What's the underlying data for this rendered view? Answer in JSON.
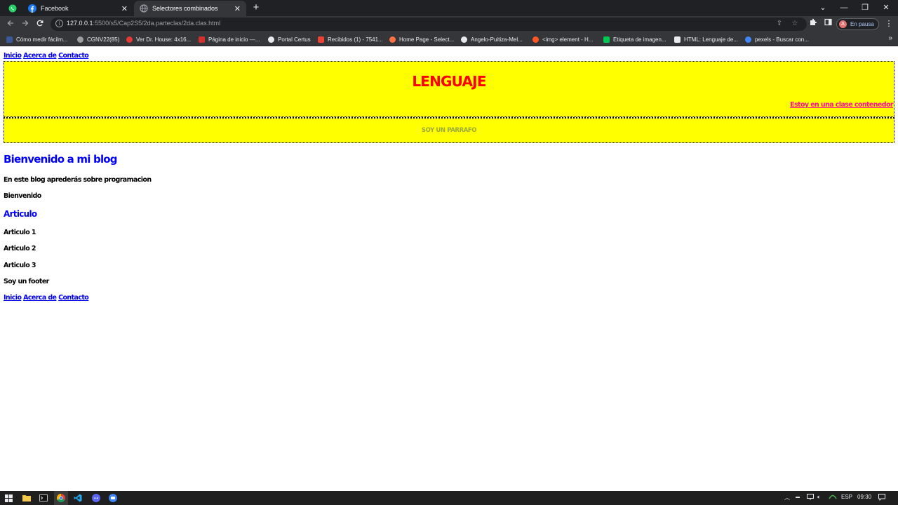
{
  "browser": {
    "tabs": [
      {
        "label": "Facebook",
        "active": false,
        "close": "✕"
      },
      {
        "label": "Selectores combinados",
        "active": true,
        "close": "✕"
      }
    ],
    "new_tab": "+",
    "window_controls": {
      "collapse": "⌄",
      "minimize": "—",
      "restore": "❐",
      "close": "✕"
    },
    "url_host": "127.0.0.1",
    "url_rest": ":5500/s5/Cap2S5/2da.parteclas/2da.clas.html",
    "profile_initial": "A",
    "profile_status": "En pausa",
    "bookmarks": [
      {
        "label": "Cómo medir fácilm...",
        "color": "#3b5998"
      },
      {
        "label": "CGNV22(85)",
        "color": "#9e9e9e"
      },
      {
        "label": "Ver Dr. House: 4x16...",
        "color": "#e53935"
      },
      {
        "label": "Página de inicio —...",
        "color": "#d32f2f"
      },
      {
        "label": "Portal Certus",
        "color": "#e8eaed"
      },
      {
        "label": "Recibidos (1) - 7541...",
        "color": "#ea4335"
      },
      {
        "label": "Home Page - Select...",
        "color": "#ff7043"
      },
      {
        "label": "Angelo-Puitiza-Mel...",
        "color": "#e8eaed"
      },
      {
        "label": "<img> element - H...",
        "color": "#ff5722"
      },
      {
        "label": "Etiqueta de imagen...",
        "color": "#00c853"
      },
      {
        "label": "HTML: Lenguaje de...",
        "color": "#e8eaed"
      },
      {
        "label": "pexels - Buscar con...",
        "color": "#4285f4"
      }
    ],
    "bookmarks_more": "»"
  },
  "page": {
    "nav_top": {
      "links": [
        "Inicio",
        "Acerca de",
        "Contacto"
      ]
    },
    "header_title": "LENGUAJE",
    "container_link": "Estoy en una clase contenedor",
    "paragraph_box": "SOY UN PARRAFO",
    "blog_title": "Bienvenido a mi blog",
    "blog_intro": "En este blog aprederás sobre programacion",
    "welcome": "Bienvenido",
    "article_heading": "Articulo",
    "articles": [
      "Articulo 1",
      "Articulo 2",
      "Articulo 3"
    ],
    "footer": "Soy un footer",
    "nav_bottom": {
      "links": [
        "Inicio",
        "Acerca de",
        "Contacto"
      ]
    }
  },
  "taskbar": {
    "language": "ESP",
    "time": "09:30"
  },
  "colors": {
    "header_bg": "#ffff00",
    "header_title": "#ff0000",
    "container_link": "#ff1493",
    "paragraph_text": "#9aab3a",
    "headings_blue": "#0000ff",
    "chrome_dark": "#202124",
    "chrome_toolbar": "#35363a"
  },
  "icons": [
    "whatsapp-icon",
    "facebook-icon",
    "globe-icon",
    "back-arrow-icon",
    "forward-arrow-icon",
    "reload-icon",
    "info-icon",
    "share-icon",
    "star-icon",
    "extensions-icon",
    "side-panel-icon",
    "menu-dots-icon",
    "windows-start-icon",
    "file-explorer-icon",
    "terminal-icon",
    "chrome-icon",
    "vscode-icon",
    "discord-icon"
  ]
}
